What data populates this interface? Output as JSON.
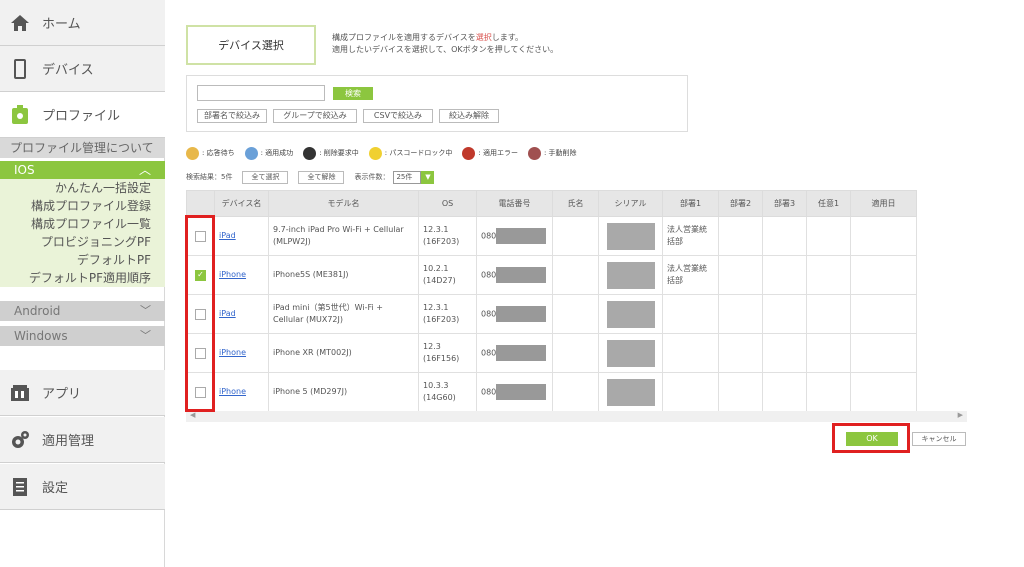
{
  "sidebar": {
    "home": "ホーム",
    "device": "デバイス",
    "profile": "プロファイル",
    "profile_about": "プロファイル管理について",
    "ios": "IOS",
    "ios_items": [
      "かんたん一括設定",
      "構成プロファイル登録",
      "構成プロファイル一覧",
      "プロビジョニングPF",
      "デフォルトPF",
      "デフォルトPF適用順序"
    ],
    "android": "Android",
    "windows": "Windows",
    "apps": "アプリ",
    "apply_mgmt": "適用管理",
    "settings": "設定"
  },
  "page": {
    "tab": "デバイス選択",
    "desc_line1_pre": "構成プロファイルを適用するデバイスを",
    "desc_line1_red": "選択",
    "desc_line1_post": "します。",
    "desc_line2": "適用したいデバイスを選択して、OKボタンを押してください。"
  },
  "search": {
    "button": "検索",
    "filters": [
      "部署名で絞込み",
      "グループで絞込み",
      "CSVで絞込み",
      "絞込み解除"
    ]
  },
  "legend": [
    {
      "label": ": 応答待ち",
      "color": "#e8b84a"
    },
    {
      "label": ": 適用成功",
      "color": "#6aa0d8"
    },
    {
      "label": ": 削除要求中",
      "color": "#333333"
    },
    {
      "label": ": パスコードロック中",
      "color": "#f0d030"
    },
    {
      "label": ": 適用エラー",
      "color": "#c0392b"
    },
    {
      "label": ": 手動削除",
      "color": "#a05050"
    }
  ],
  "controls": {
    "result": "検索結果：5件",
    "select_all": "全て選択",
    "deselect_all": "全て解除",
    "per_page_label": "表示件数：",
    "per_page": "25件"
  },
  "table": {
    "headers": [
      "",
      "デバイス名",
      "モデル名",
      "OS",
      "電話番号",
      "氏名",
      "シリアル",
      "部署1",
      "部署2",
      "部署3",
      "任意1",
      "適用日"
    ],
    "rows": [
      {
        "checked": false,
        "device": "iPad",
        "model": "9.7-inch iPad Pro Wi-Fi + Cellular (MLPW2J)",
        "os": "12.3.1 (16F203)",
        "phone": "080",
        "dept1": "法人営業統括部",
        "serial_shown": true
      },
      {
        "checked": true,
        "device": "iPhone",
        "model": "iPhone5S (ME381J)",
        "os": "10.2.1 (14D27)",
        "phone": "080",
        "dept1": "法人営業統括部",
        "serial_shown": true
      },
      {
        "checked": false,
        "device": "iPad",
        "model": "iPad mini（第5世代）Wi-Fi + Cellular (MUX72J)",
        "os": "12.3.1 (16F203)",
        "phone": "080",
        "dept1": "",
        "serial_shown": true
      },
      {
        "checked": false,
        "device": "iPhone",
        "model": "iPhone XR (MT002J)",
        "os": "12.3 (16F156)",
        "phone": "080",
        "dept1": "",
        "serial_shown": true
      },
      {
        "checked": false,
        "device": "iPhone",
        "model": "iPhone 5 (MD297J)",
        "os": "10.3.3 (14G60)",
        "phone": "080",
        "dept1": "",
        "serial_shown": true
      }
    ]
  },
  "actions": {
    "ok": "OK",
    "cancel": "キャンセル"
  },
  "colors": {
    "accent": "#8cc63f",
    "highlight": "#e02020"
  }
}
